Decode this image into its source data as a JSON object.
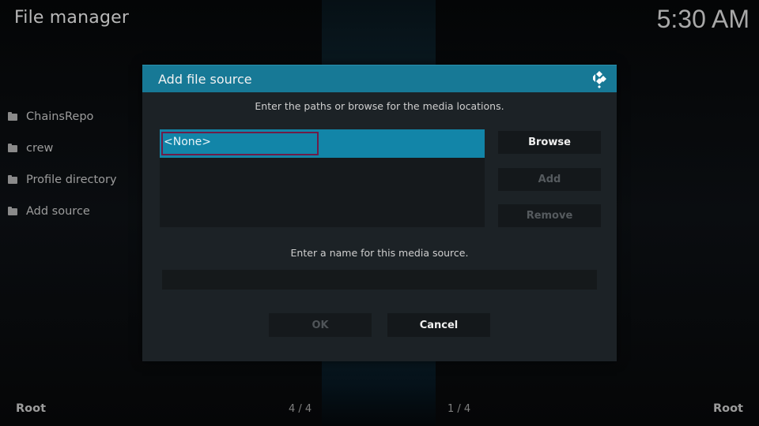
{
  "app": {
    "title": "File manager",
    "clock": "5:30 AM"
  },
  "sidebar": {
    "items": [
      {
        "label": "ChainsRepo",
        "icon": "folder-icon"
      },
      {
        "label": "crew",
        "icon": "folder-icon"
      },
      {
        "label": "Profile directory",
        "icon": "folder-icon"
      },
      {
        "label": "Add source",
        "icon": "folder-icon"
      }
    ]
  },
  "footer": {
    "left_path": "Root",
    "left_count": "4 / 4",
    "right_count": "1 / 4",
    "right_path": "Root"
  },
  "dialog": {
    "title": "Add file source",
    "logo_icon": "kodi-logo-icon",
    "paths_instruction": "Enter the paths or browse for the media locations.",
    "paths": [
      {
        "value": "<None>",
        "selected": true
      }
    ],
    "buttons": {
      "browse": "Browse",
      "add": "Add",
      "remove": "Remove",
      "ok": "OK",
      "cancel": "Cancel"
    },
    "name_instruction": "Enter a name for this media source.",
    "name_value": "",
    "accent_color": "#177996",
    "selection_color": "#1285a8",
    "focus_border_color": "#6e1c47"
  }
}
